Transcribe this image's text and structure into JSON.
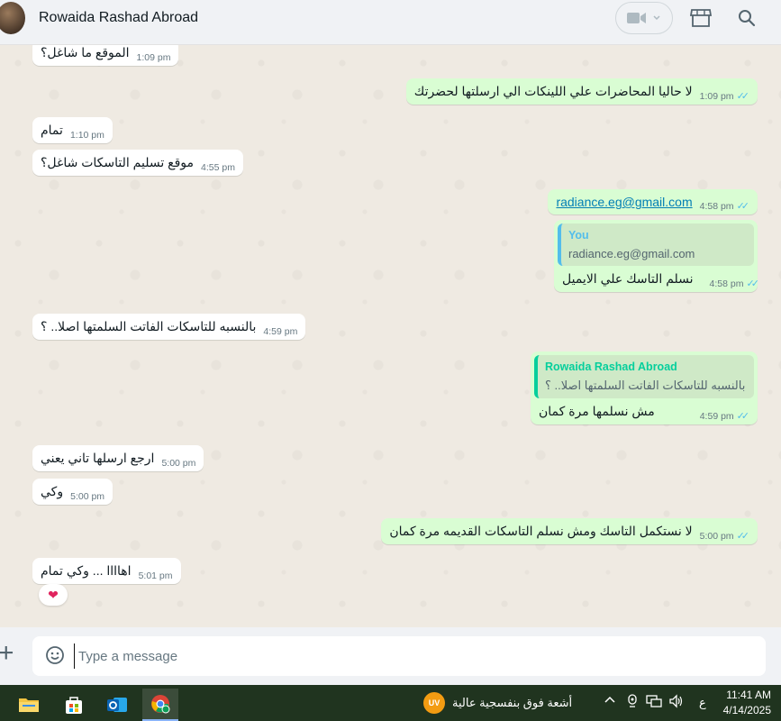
{
  "header": {
    "contact_name": "Rowaida Rashad Abroad"
  },
  "messages": {
    "m0": {
      "text": "الموقع ما شاغل؟",
      "time": "1:09 pm"
    },
    "m1": {
      "text": "لا حاليا المحاضرات علي اللينكات الي ارسلتها لحضرتك",
      "time": "1:09 pm"
    },
    "m2": {
      "text": "تمام",
      "time": "1:10 pm"
    },
    "m3": {
      "text": "موقع تسليم التاسكات شاغل؟",
      "time": "4:55 pm"
    },
    "m4": {
      "text": "radiance.eg@gmail.com",
      "time": "4:58 pm"
    },
    "m5": {
      "quote_author": "You",
      "quote_text": "radiance.eg@gmail.com",
      "text": "نسلم التاسك علي الايميل",
      "time": "4:58 pm"
    },
    "m6": {
      "text": "بالنسبه للتاسكات الفاتت السلمتها اصلا.. ؟",
      "time": "4:59 pm"
    },
    "m7": {
      "quote_author": "Rowaida Rashad Abroad",
      "quote_text": "بالنسبه للتاسكات الفاتت السلمتها اصلا.. ؟",
      "text": "مش نسلمها مرة كمان",
      "time": "4:59 pm"
    },
    "m8": {
      "text": "ارجع ارسلها تاني يعني",
      "time": "5:00 pm"
    },
    "m9": {
      "text": "وكي",
      "time": "5:00 pm"
    },
    "m10": {
      "text": "لا نستكمل التاسك ومش نسلم التاسكات القديمه مرة كمان",
      "time": "5:00 pm"
    },
    "m11": {
      "text": "اهاااا ... وكي تمام",
      "time": "5:01 pm",
      "reaction": "❤"
    }
  },
  "composer": {
    "placeholder": "Type a message"
  },
  "taskbar": {
    "weather_badge": "UV",
    "weather_text": "أشعة فوق بنفسجية عالية",
    "lang": "ع",
    "time": "11:41 AM",
    "date": "4/14/2025"
  },
  "colors": {
    "outgoing": "#d9fdd3",
    "incoming": "#ffffff",
    "read_ticks": "#53bdeb",
    "background": "#efeae2",
    "taskbar": "#20341f"
  },
  "icons": [
    "video-camera-icon",
    "chevron-down-icon",
    "store-icon",
    "search-icon",
    "plus-icon",
    "emoji-icon",
    "file-explorer-icon",
    "store-app-icon",
    "outlook-icon",
    "chrome-icon",
    "chevron-up-icon",
    "webcam-icon",
    "network-icon",
    "volume-icon"
  ]
}
